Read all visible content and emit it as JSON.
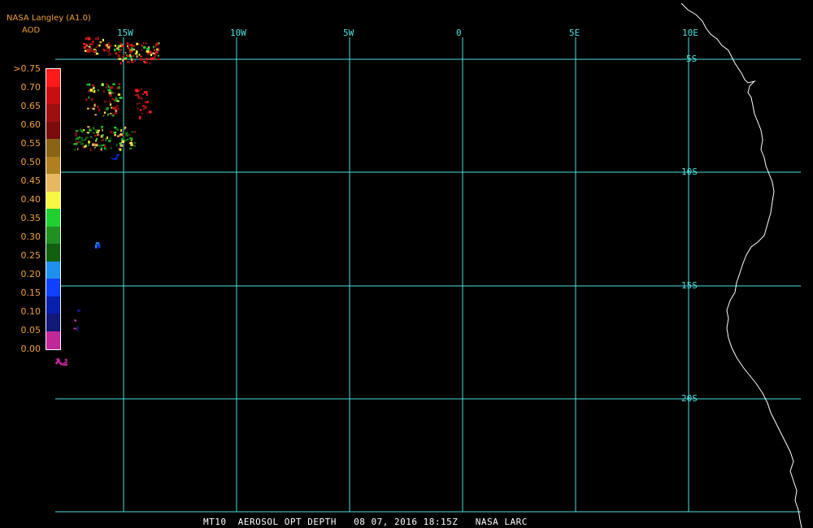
{
  "header": {
    "source": "NASA Langley (A1.0)",
    "product": "AOD"
  },
  "legend": {
    "labels": [
      ">0.75",
      "0.70",
      "0.65",
      "0.60",
      "0.55",
      "0.50",
      "0.45",
      "0.40",
      "0.35",
      "0.30",
      "0.25",
      "0.20",
      "0.15",
      "0.10",
      "0.05",
      "0.00"
    ],
    "colors": [
      "#ff1a1a",
      "#c80f0f",
      "#9e1010",
      "#7a0c0c",
      "#8a6414",
      "#b08020",
      "#e8b860",
      "#f8f840",
      "#20d030",
      "#209020",
      "#106010",
      "#2090f0",
      "#1040ff",
      "#0820b0",
      "#101878",
      "#c0289a"
    ]
  },
  "grid": {
    "lon_labels": [
      "15W",
      "10W",
      "5W",
      "0",
      "5E",
      "10E"
    ],
    "lat_labels": [
      "5S",
      "10S",
      "15S",
      "20S"
    ]
  },
  "footer": {
    "text": "MT10  AEROSOL OPT DEPTH   08 07, 2016 18:15Z   NASA LARC"
  },
  "colors": {
    "grid": "#50e0e0",
    "coast": "#ffffff",
    "label": "#f0a040"
  }
}
